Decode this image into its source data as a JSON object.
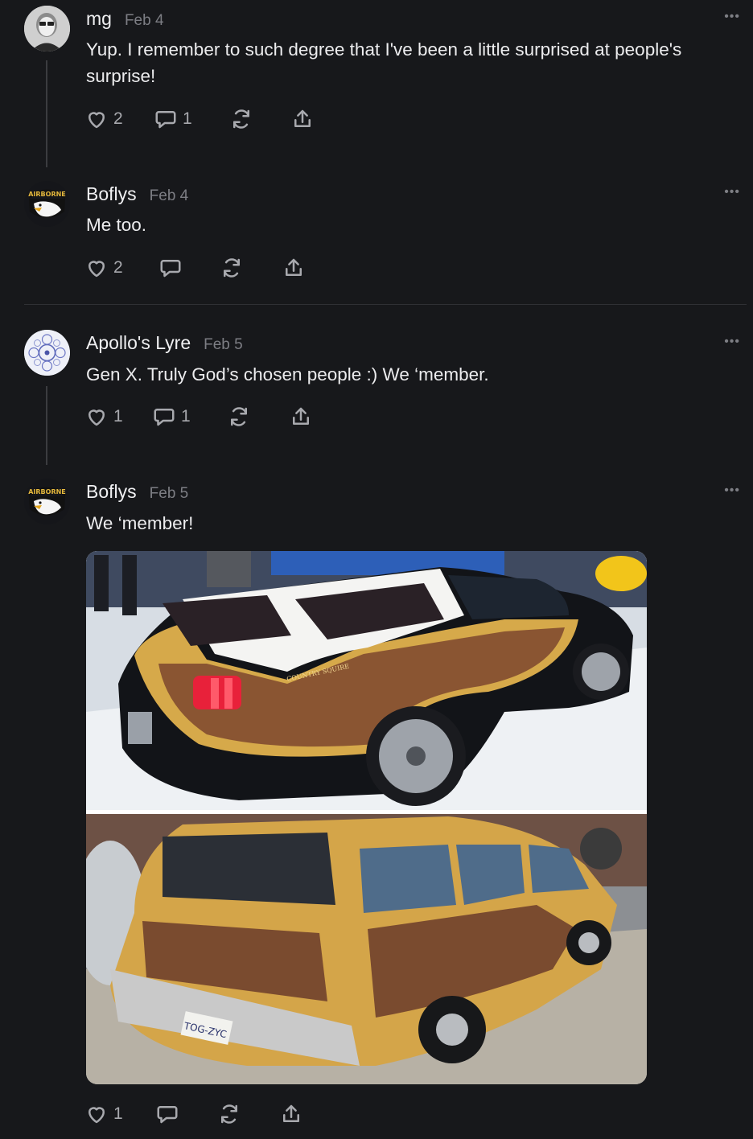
{
  "comments": [
    {
      "author": "mg",
      "date": "Feb 4",
      "text": "Yup. I remember to such degree that I've been a little surprised at people's surprise!",
      "likes": "2",
      "replies": "1",
      "more": "•••"
    },
    {
      "author": "Boflys",
      "date": "Feb 4",
      "text": "Me too.",
      "likes": "2",
      "replies": "",
      "more": "•••",
      "avatar_text": "AIRBORNE"
    },
    {
      "author": "Apollo's Lyre",
      "date": "Feb 5",
      "text": "Gen X. Truly God’s chosen people :) We ‘member.",
      "likes": "1",
      "replies": "1",
      "more": "•••"
    },
    {
      "author": "Boflys",
      "date": "Feb 5",
      "text": "We ‘member!",
      "likes": "1",
      "replies": "",
      "more": "•••",
      "avatar_text": "AIRBORNE",
      "image": {
        "top_plate": "COUNTRY SQUIRE",
        "bottom_plate": "TOG-ZYC"
      }
    }
  ],
  "icons": [
    "heart-icon",
    "comment-icon",
    "restack-icon",
    "share-icon",
    "more-icon"
  ],
  "colors": {
    "background": "#17181b",
    "text": "#ececee",
    "muted": "#7d7e84",
    "wood": "#8a5a33",
    "mustard": "#d8ab52"
  }
}
